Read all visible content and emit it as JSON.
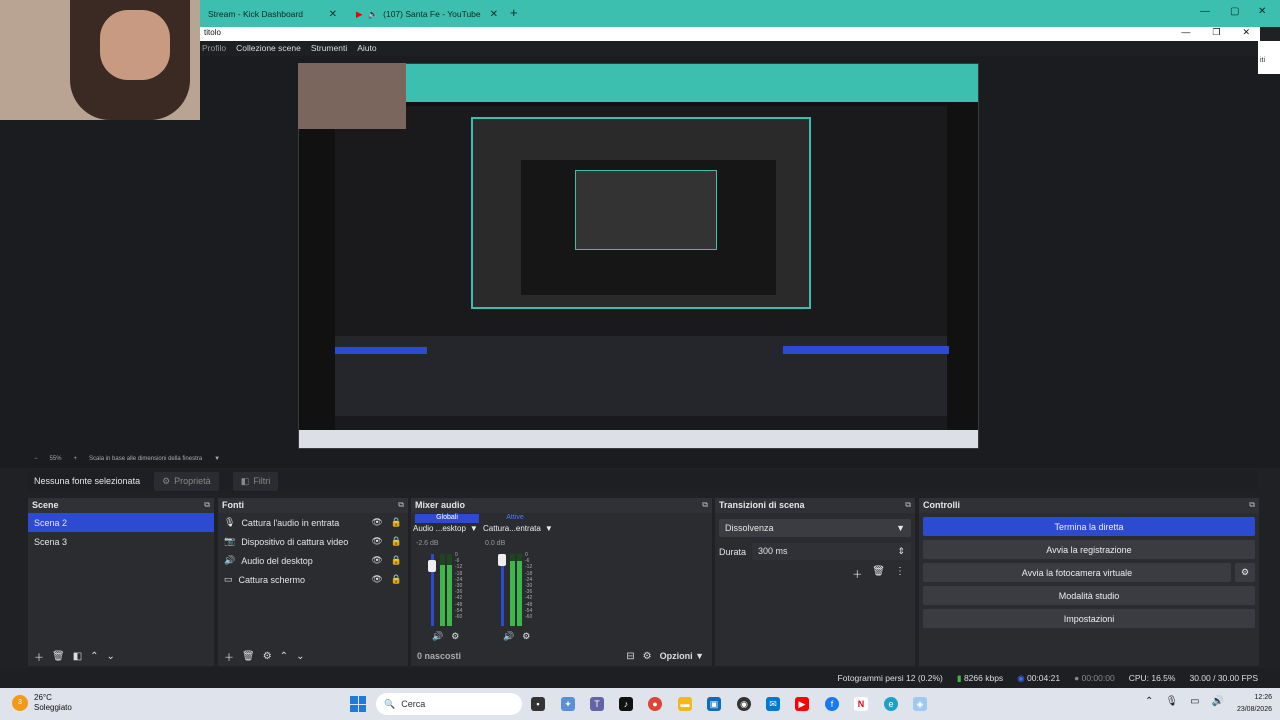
{
  "browser": {
    "tabs": [
      {
        "label": "Stream - Kick Dashboard"
      },
      {
        "label": "(107) Santa Fe - YouTube"
      }
    ],
    "new_tab": "+"
  },
  "window": {
    "title": "titolo",
    "controls": [
      "—",
      "❐",
      "✕"
    ]
  },
  "menu": [
    "Profilo",
    "Collezione scene",
    "Strumenti",
    "Aiuto"
  ],
  "right_strip_text": "iti",
  "zoom": {
    "zoom_level": "55%",
    "scale_mode": "Scala in base alle dimensioni della finestra"
  },
  "source_bar": {
    "label": "Nessuna fonte selezionata",
    "properties": "Proprietà",
    "filters": "Filtri"
  },
  "scenes": {
    "title": "Scene",
    "items": [
      {
        "label": "Scena 2",
        "selected": true
      },
      {
        "label": "Scena 3",
        "selected": false
      }
    ]
  },
  "sources": {
    "title": "Fonti",
    "items": [
      {
        "label": "Cattura l'audio in entrata",
        "icon": "microphone-icon"
      },
      {
        "label": "Dispositivo di cattura video",
        "icon": "camera-icon"
      },
      {
        "label": "Audio del desktop",
        "icon": "speaker-icon"
      },
      {
        "label": "Cattura schermo",
        "icon": "monitor-icon"
      }
    ]
  },
  "mixer": {
    "title": "Mixer audio",
    "tab_global": "Globali",
    "tab_active": "Attive",
    "channels": [
      {
        "name": "Audio ...esktop",
        "db": "-2.6 dB",
        "level": 0.85
      },
      {
        "name": "Cattura...entrata",
        "db": "0.0 dB",
        "level": 0.9
      }
    ],
    "hidden": "0 nascosti",
    "options": "Opzioni"
  },
  "transitions": {
    "title": "Transizioni di scena",
    "selected": "Dissolvenza",
    "duration_label": "Durata",
    "duration": "300 ms"
  },
  "controls": {
    "title": "Controlli",
    "buttons": {
      "stop_stream": "Termina la diretta",
      "start_rec": "Avvia la registrazione",
      "virtual_cam": "Avvia la fotocamera virtuale",
      "studio": "Modalità studio",
      "settings": "Impostazioni"
    }
  },
  "status": {
    "dropped": "Fotogrammi persi 12 (0.2%)",
    "bitrate": "8266 kbps",
    "live_time": "00:04:21",
    "rec_time": "00:00:00",
    "cpu": "CPU: 16.5%",
    "fps": "30.00 / 30.00 FPS"
  },
  "taskbar": {
    "temp": "26°C",
    "weather": "Soleggiato",
    "search": "Cerca",
    "time": "12:26",
    "date": "23/08/2026",
    "badge": "3"
  },
  "colors": {
    "accent": "#2d4bd1",
    "chrome": "#3cbfae",
    "meter": "#3eb64a"
  }
}
